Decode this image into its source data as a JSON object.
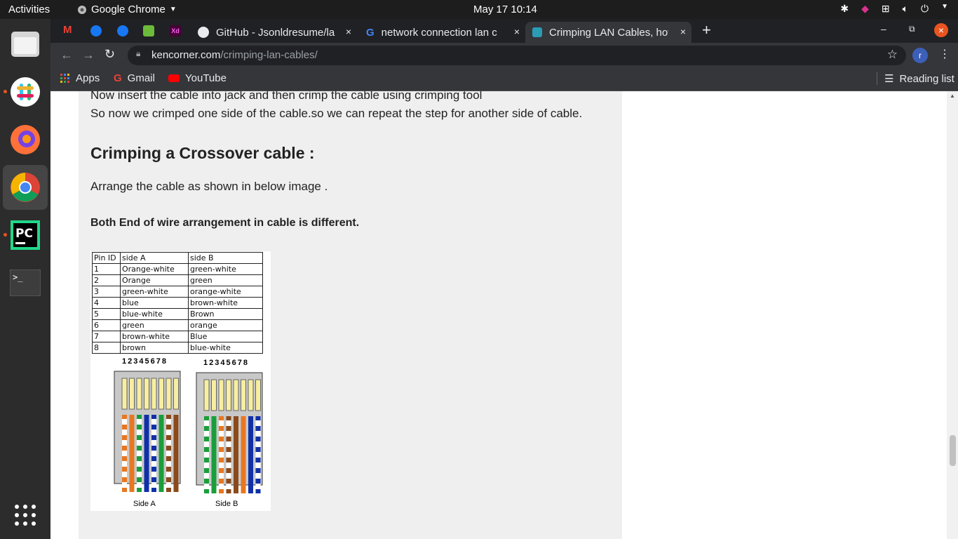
{
  "topbar": {
    "activities": "Activities",
    "app_name": "Google Chrome",
    "clock": "May 17  10:14"
  },
  "tabs": [
    {
      "title": "GitHub - Jsonldresume/la",
      "close": "×"
    },
    {
      "title": "network connection lan c",
      "close": "×"
    },
    {
      "title": "Crimping LAN Cables, hov",
      "close": "×"
    }
  ],
  "new_tab": "+",
  "address": {
    "domain": "kencorner.com",
    "path": "/crimping-lan-cables/"
  },
  "profile_initial": "r",
  "bookmarks": {
    "apps": "Apps",
    "gmail": "Gmail",
    "youtube": "YouTube",
    "reading_list": "Reading list"
  },
  "article": {
    "line1": "Now insert the cable into jack and then crimp the cable using crimping tool",
    "line2": "So now we crimped one side of the cable.so we can repeat the step for another side of cable.",
    "heading": "Crimping a Crossover cable :",
    "arrange": "Arrange the cable as shown in below image .",
    "bold_note": "Both End of wire arrangement in cable is different."
  },
  "figure": {
    "headers": [
      "Pin ID",
      "side A",
      "side B"
    ],
    "rows": [
      [
        "1",
        "Orange-white",
        "green-white"
      ],
      [
        "2",
        "Orange",
        "green"
      ],
      [
        "3",
        "green-white",
        "orange-white"
      ],
      [
        "4",
        "blue",
        "brown-white"
      ],
      [
        "5",
        "blue-white",
        "Brown"
      ],
      [
        "6",
        "green",
        "orange"
      ],
      [
        "7",
        "brown-white",
        "Blue"
      ],
      [
        "8",
        "brown",
        "blue-white"
      ]
    ],
    "pin_numbers": "12345678",
    "side_a_label": "Side A",
    "side_b_label": "Side B",
    "colors": {
      "orange": "#e87722",
      "green": "#1a9e3c",
      "blue": "#1030a8",
      "brown": "#8b4a1a",
      "white": "#ffffff"
    }
  },
  "theme": {
    "chrome_dark": "#202124",
    "chrome_mid": "#35363a",
    "ubuntu_accent": "#e95420",
    "content_bg": "#efefef"
  }
}
